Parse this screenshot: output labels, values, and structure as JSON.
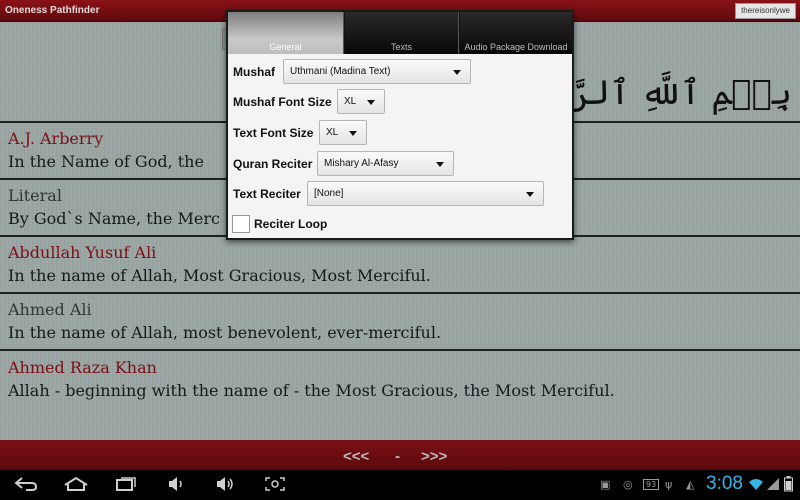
{
  "app": {
    "title": "Oneness Pathfinder",
    "user": "thereisonlywe"
  },
  "basmala": "بِسۡمِ ٱللَّهِ ٱلرَّحۡمَٰنِ ٱلرَّحِيمِ",
  "translations": [
    {
      "name": "A.J. Arberry",
      "text": "In the Name of God, the"
    },
    {
      "name": "Literal",
      "text": "By God`s Name, the Merc"
    },
    {
      "name": "Abdullah Yusuf Ali",
      "text": "In the name of Allah, Most Gracious, Most Merciful."
    },
    {
      "name": "Ahmed Ali",
      "text": "In the name of Allah, most benevolent, ever-merciful."
    },
    {
      "name": "Ahmed Raza Khan",
      "text": "Allah - beginning with the name of - the Most Gracious, the Most Merciful."
    }
  ],
  "navigation": {
    "prev": "<<<",
    "separator": "-",
    "next": ">>>"
  },
  "dialog": {
    "tabs": [
      "General",
      "Texts",
      "Audio Package Download"
    ],
    "active_tab": "General",
    "fields": {
      "mushaf": {
        "label": "Mushaf",
        "value": "Uthmani (Madina Text)"
      },
      "mushaf_font_size": {
        "label": "Mushaf Font Size",
        "value": "XL"
      },
      "text_font_size": {
        "label": "Text Font Size",
        "value": "XL"
      },
      "quran_reciter": {
        "label": "Quran Reciter",
        "value": "Mishary Al-Afasy"
      },
      "text_reciter": {
        "label": "Text Reciter",
        "value": "[None]"
      },
      "reciter_loop": {
        "label": "Reciter Loop",
        "checked": false
      }
    }
  },
  "statusbar": {
    "clock": "3:08",
    "notification_count": "93"
  },
  "colors": {
    "accent": "#33b5e5",
    "brand": "#7d0f14"
  }
}
